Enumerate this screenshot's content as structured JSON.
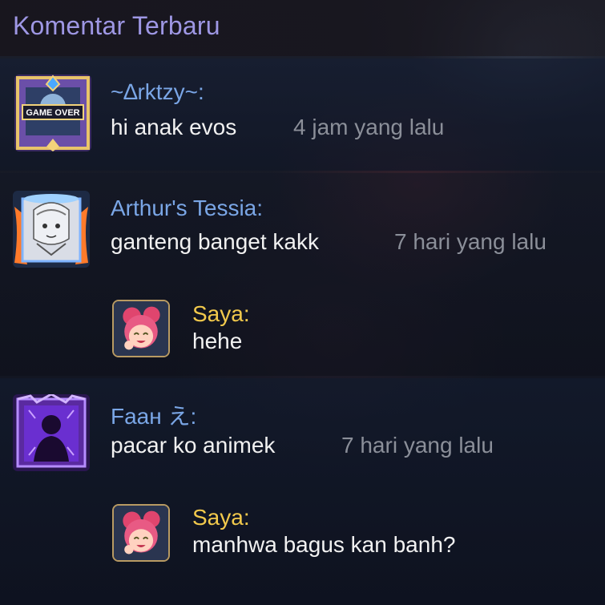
{
  "header": {
    "title": "Komentar Terbaru"
  },
  "comments": [
    {
      "name": "~∆rktzy~:",
      "message": "hi anak evos",
      "time": "4 jam yang lalu",
      "avatar_icon": "game-over-frame-icon",
      "avatar_badge": "GAME OVER"
    },
    {
      "name": "Arthur's Tessia:",
      "message": "ganteng banget kakk",
      "time": "7 hari yang lalu",
      "avatar_icon": "anime-portrait-frame-icon",
      "reply": {
        "name": "Saya:",
        "message": "hehe",
        "avatar_icon": "pink-hero-avatar-icon"
      }
    },
    {
      "name": "Faaн え:",
      "message": "pacar ko animek",
      "time": "7 hari yang lalu",
      "avatar_icon": "purple-silhouette-frame-icon",
      "reply": {
        "name": "Saya:",
        "message": "manhwa bagus kan banh?",
        "avatar_icon": "pink-hero-avatar-icon"
      }
    }
  ],
  "colors": {
    "title": "#9e97e4",
    "username": "#7aa6e6",
    "self_username": "#f2c94c",
    "message": "#f1f1f1",
    "timestamp": "#8b8f99"
  }
}
